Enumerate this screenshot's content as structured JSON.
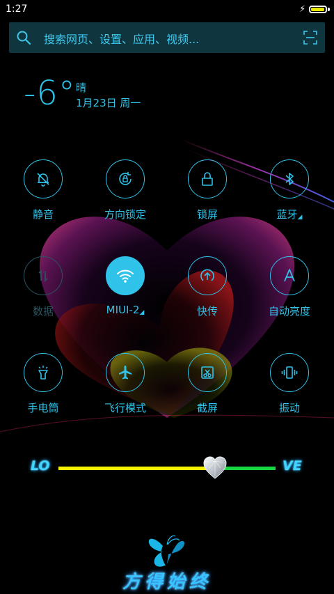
{
  "status_bar": {
    "time": "1:27",
    "battery_level": 0.95,
    "charging_icon": "bolt-icon"
  },
  "search": {
    "placeholder": "搜索网页、设置、应用、视频...",
    "search_icon": "search-icon",
    "scan_icon": "scan-icon"
  },
  "weather": {
    "temperature": "-6°",
    "condition": "晴",
    "date": "1月23日 周一"
  },
  "quick_settings": [
    {
      "label": "静音",
      "icon": "bell-off-icon",
      "state": "off"
    },
    {
      "label": "方向锁定",
      "icon": "rotation-lock-icon",
      "state": "off"
    },
    {
      "label": "锁屏",
      "icon": "lock-icon",
      "state": "off"
    },
    {
      "label": "蓝牙",
      "icon": "bluetooth-icon",
      "state": "off",
      "expandable": true
    },
    {
      "label": "数据",
      "icon": "mobile-data-icon",
      "state": "disabled"
    },
    {
      "label": "MIUI-2",
      "icon": "wifi-icon",
      "state": "on",
      "expandable": true
    },
    {
      "label": "快传",
      "icon": "quick-transfer-icon",
      "state": "off"
    },
    {
      "label": "自动亮度",
      "icon": "auto-brightness-icon",
      "state": "off"
    },
    {
      "label": "手电筒",
      "icon": "flashlight-icon",
      "state": "off"
    },
    {
      "label": "飞行模式",
      "icon": "airplane-icon",
      "state": "off"
    },
    {
      "label": "截屏",
      "icon": "screenshot-icon",
      "state": "off"
    },
    {
      "label": "振动",
      "icon": "vibrate-icon",
      "state": "off"
    }
  ],
  "brightness_slider": {
    "left_label": "LO",
    "right_label": "VE",
    "value": 0.72,
    "thumb_icon": "heart-diamond-icon"
  },
  "footer": {
    "logo_icon": "butterfly-icon",
    "slogan": "方得始终"
  },
  "colors": {
    "accent": "#2fc3ea",
    "background": "#000000",
    "slider_left": "#f3f300",
    "slider_right": "#18d640"
  }
}
